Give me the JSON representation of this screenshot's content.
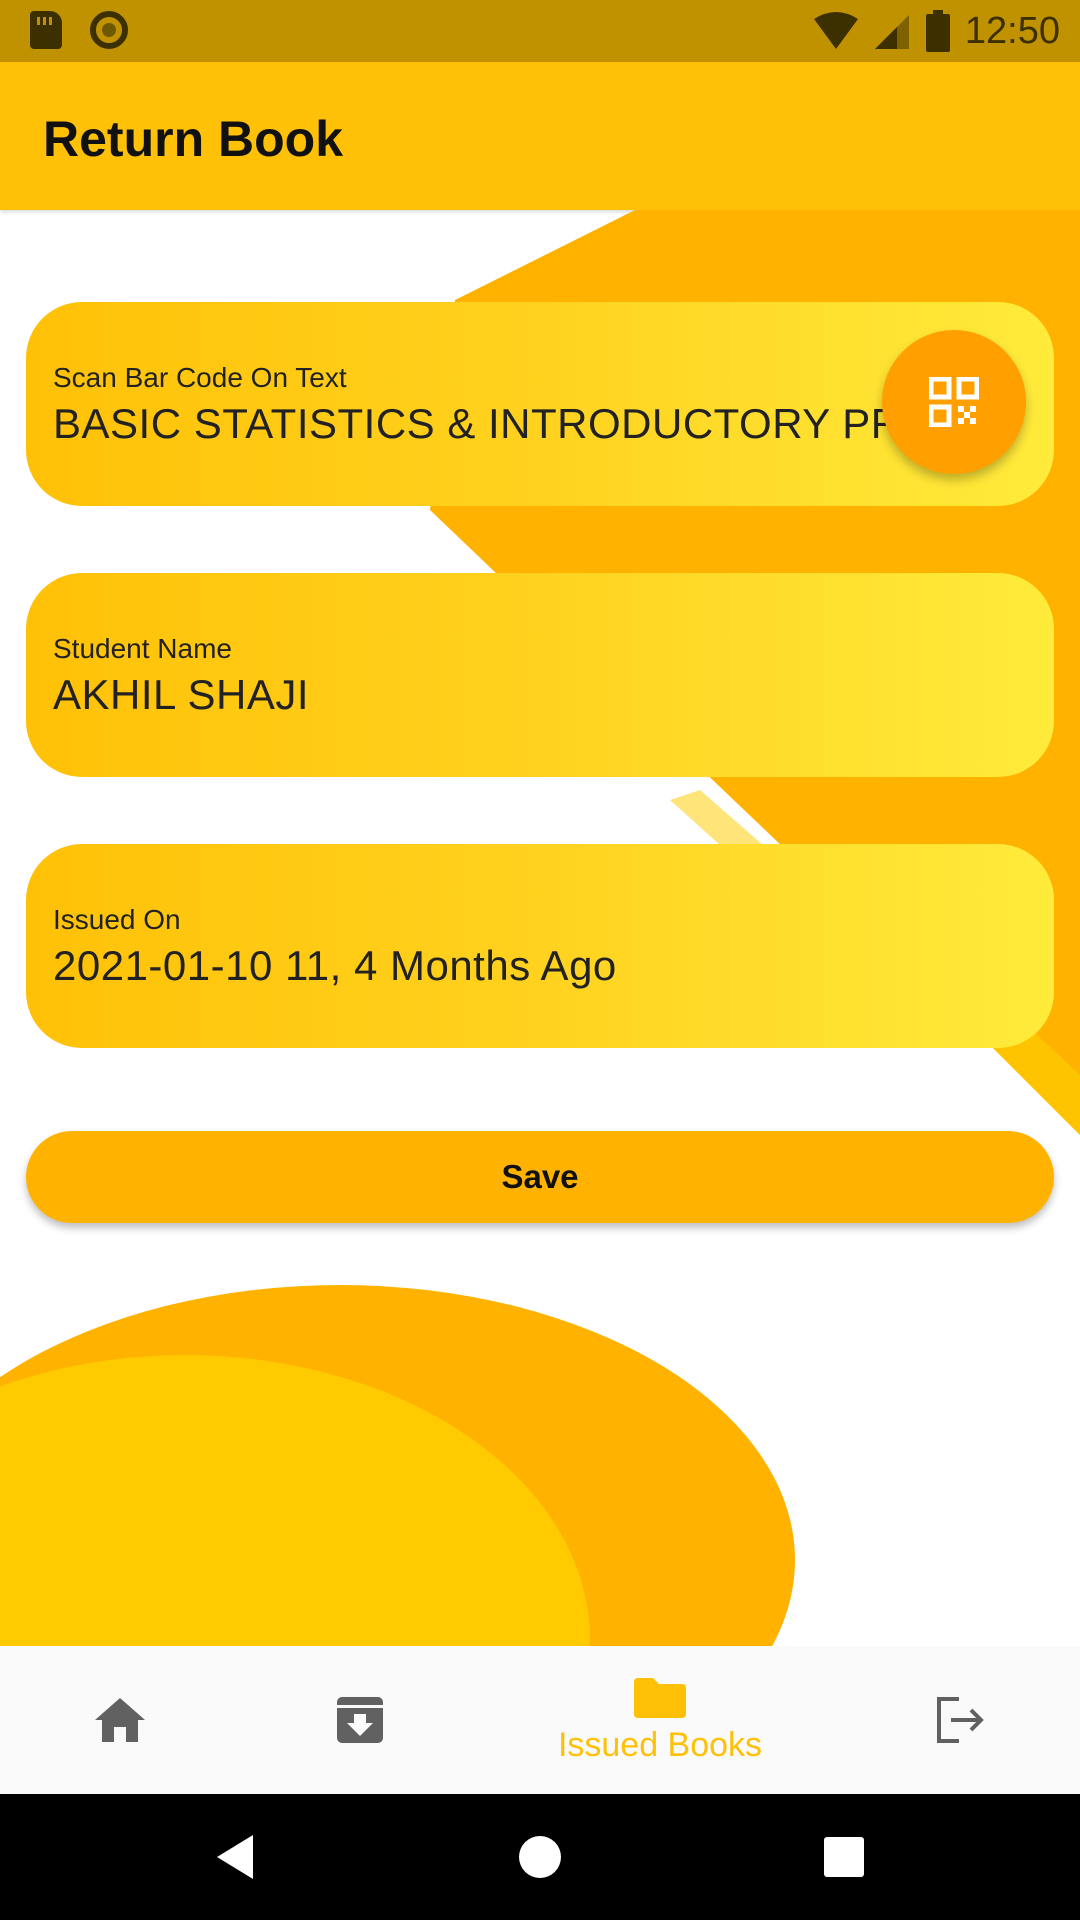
{
  "status_bar": {
    "time": "12:50",
    "left_icons": [
      "sd-card-icon",
      "circle-icon"
    ],
    "right_icons": [
      "wifi-icon",
      "signal-icon",
      "battery-icon"
    ]
  },
  "app_bar": {
    "title": "Return Book"
  },
  "form": {
    "book": {
      "label": "Scan Bar Code On Text",
      "value": "BASIC STATISTICS & INTRODUCTORY PROBA"
    },
    "student": {
      "label": "Student Name",
      "value": "AKHIL SHAJI"
    },
    "issued": {
      "label": "Issued On",
      "value": "2021-01-10 11, 4 Months Ago"
    },
    "scan_button_icon": "qr-code-icon",
    "save_label": "Save"
  },
  "bottom_nav": {
    "items": [
      {
        "icon": "home-icon",
        "label": ""
      },
      {
        "icon": "archive-icon",
        "label": ""
      },
      {
        "icon": "folder-icon",
        "label": "Issued Books",
        "active": true
      },
      {
        "icon": "logout-icon",
        "label": ""
      }
    ],
    "active_color": "#ffc107",
    "inactive_color": "#616161"
  },
  "colors": {
    "primary": "#ffc107",
    "accent": "#ffa000",
    "status_bar": "#c19200"
  }
}
